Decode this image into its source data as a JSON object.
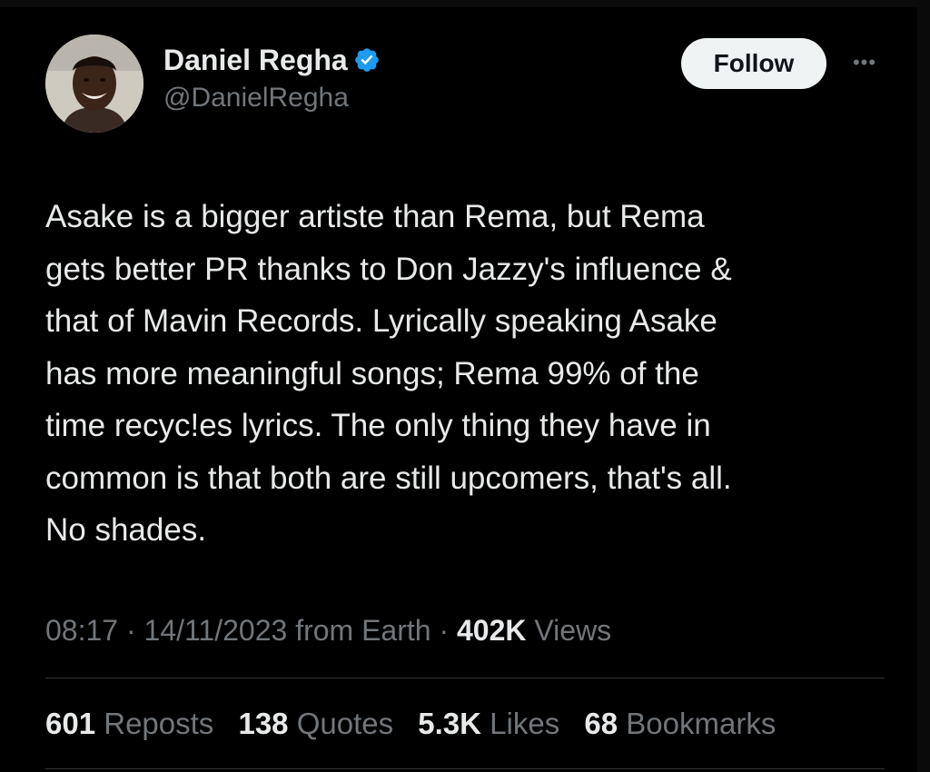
{
  "author": {
    "display_name": "Daniel Regha",
    "handle": "@DanielRegha",
    "verified_icon": "verified-badge-icon",
    "verified_color": "#1d9bf0"
  },
  "actions": {
    "follow_label": "Follow",
    "more_label": "•••"
  },
  "tweet": {
    "text": "Asake is a bigger artiste than Rema, but Rema\ngets better PR thanks to Don Jazzy's influence &\nthat of Mavin Records. Lyrically speaking Asake\nhas more meaningful songs; Rema 99% of the\ntime recyc!es lyrics. The only thing they have in\ncommon is that both are still upcomers, that's all.\nNo shades."
  },
  "meta": {
    "time": "08:17",
    "separator": "·",
    "date": "14/11/2023",
    "source": "from Earth",
    "views_count": "402K",
    "views_label": "Views"
  },
  "stats": [
    {
      "count": "601",
      "label": "Reposts"
    },
    {
      "count": "138",
      "label": "Quotes"
    },
    {
      "count": "5.3K",
      "label": "Likes"
    },
    {
      "count": "68",
      "label": "Bookmarks"
    }
  ],
  "colors": {
    "background": "#000000",
    "text_primary": "#e7e9ea",
    "text_secondary": "#71767b",
    "divider": "#2f3336",
    "follow_bg": "#eff3f4"
  }
}
